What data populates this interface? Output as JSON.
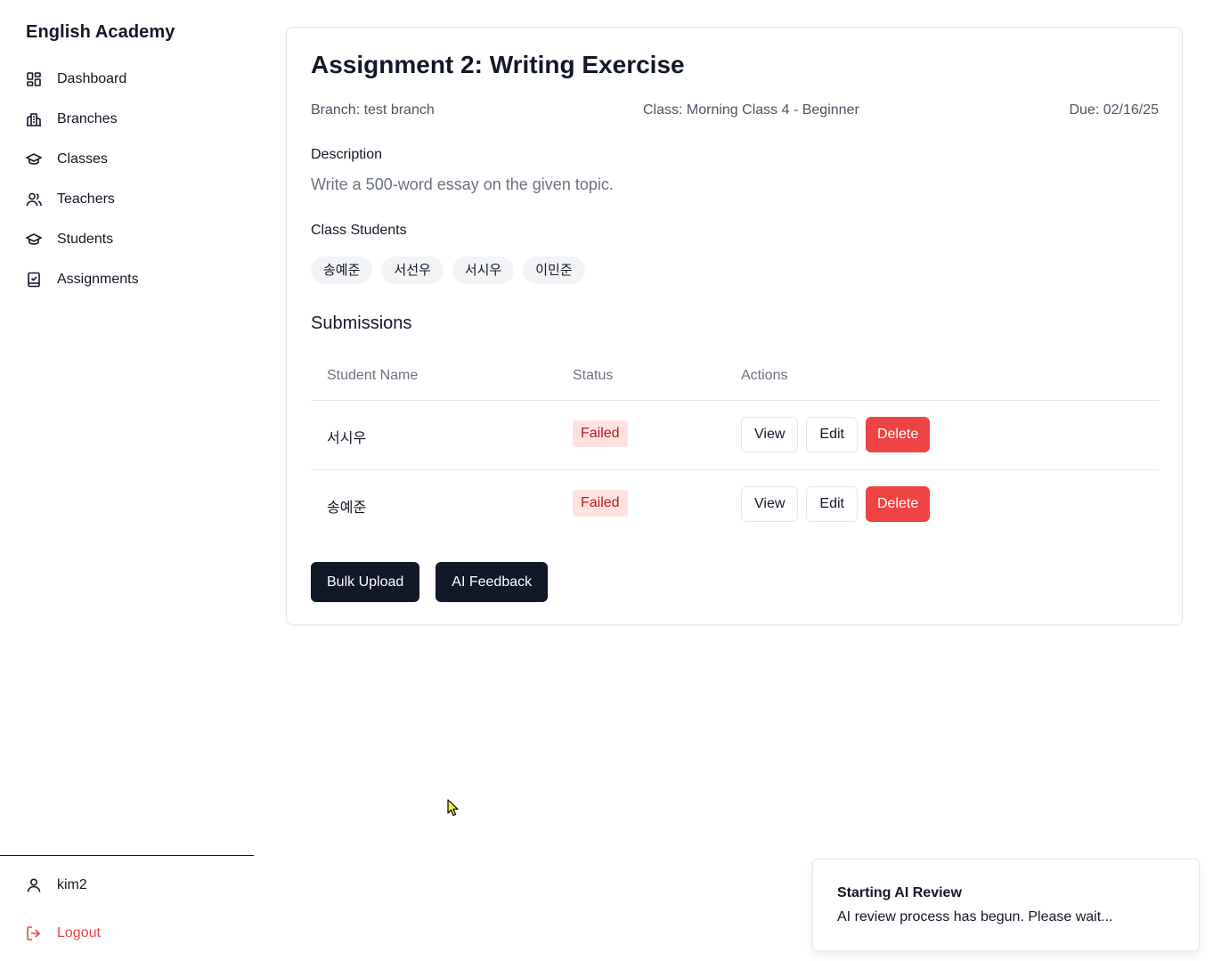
{
  "sidebar": {
    "brand": "English Academy",
    "items": [
      {
        "label": "Dashboard",
        "icon": "dashboard-icon"
      },
      {
        "label": "Branches",
        "icon": "building-icon"
      },
      {
        "label": "Classes",
        "icon": "graduation-cap-icon"
      },
      {
        "label": "Teachers",
        "icon": "users-icon"
      },
      {
        "label": "Students",
        "icon": "graduation-cap-icon"
      },
      {
        "label": "Assignments",
        "icon": "notebook-check-icon"
      }
    ],
    "user": {
      "name": "kim2",
      "icon": "user-icon"
    },
    "logout": {
      "label": "Logout",
      "icon": "logout-icon"
    }
  },
  "assignment": {
    "title": "Assignment 2: Writing Exercise",
    "branch": "Branch: test branch",
    "class": "Class: Morning Class 4 - Beginner",
    "due": "Due: 02/16/25",
    "description_label": "Description",
    "description": "Write a 500-word essay on the given topic.",
    "students_label": "Class Students",
    "students": [
      "송예준",
      "서선우",
      "서시우",
      "이민준"
    ]
  },
  "submissions": {
    "title": "Submissions",
    "columns": [
      "Student Name",
      "Status",
      "Actions"
    ],
    "rows": [
      {
        "name": "서시우",
        "status": "Failed"
      },
      {
        "name": "송예준",
        "status": "Failed"
      }
    ],
    "actions": {
      "view": "View",
      "edit": "Edit",
      "delete": "Delete"
    }
  },
  "buttons": {
    "bulk_upload": "Bulk Upload",
    "ai_feedback": "AI Feedback"
  },
  "toast": {
    "title": "Starting AI Review",
    "message": "AI review process has begun. Please wait..."
  },
  "colors": {
    "primary_dark": "#111827",
    "danger": "#ef4444",
    "badge_bg": "#fee2e2",
    "badge_text": "#b91c1c"
  }
}
